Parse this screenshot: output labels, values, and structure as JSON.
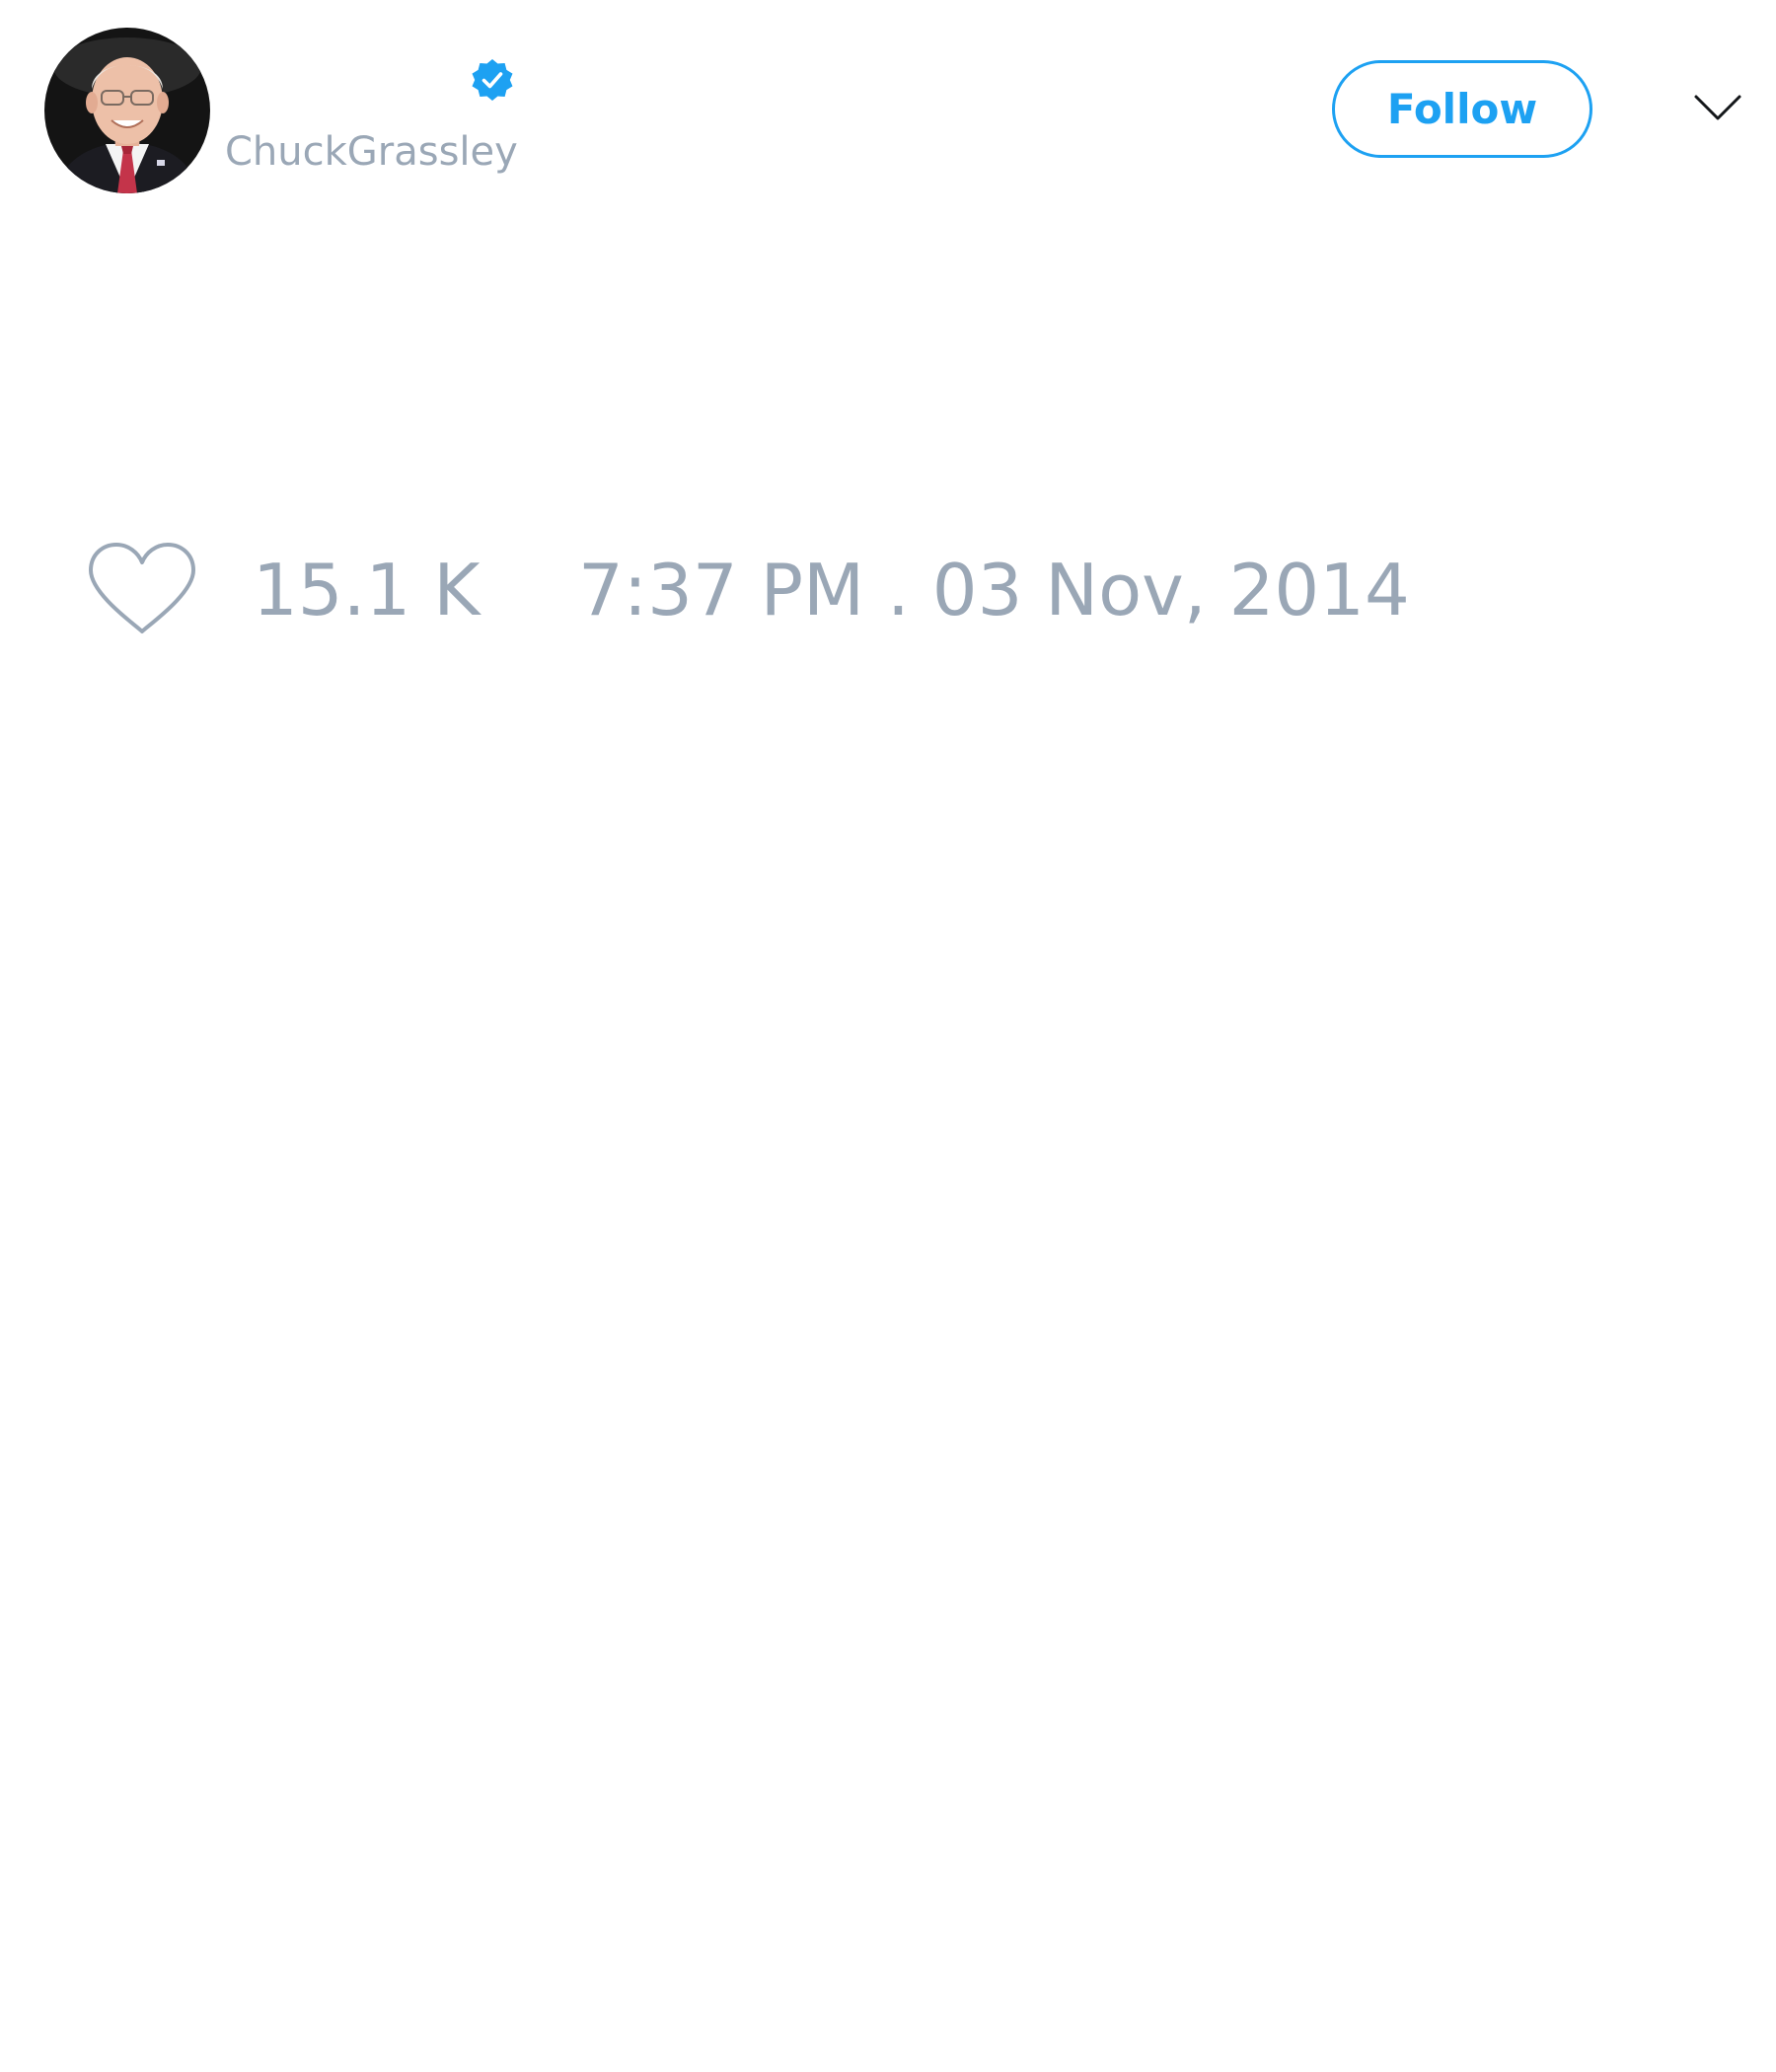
{
  "header": {
    "handle": "ChuckGrassley",
    "verified": true,
    "follow_label": "Follow",
    "menu_icon": "chevron-down-icon",
    "avatar_icon": "avatar"
  },
  "tweet": {
    "like_icon": "heart-icon",
    "like_count": "15.1 K",
    "timestamp": "7:37 PM . 03 Nov, 2014"
  },
  "colors": {
    "accent": "#1da1f2",
    "muted_text": "#9aa7b6",
    "background": "#ffffff"
  }
}
